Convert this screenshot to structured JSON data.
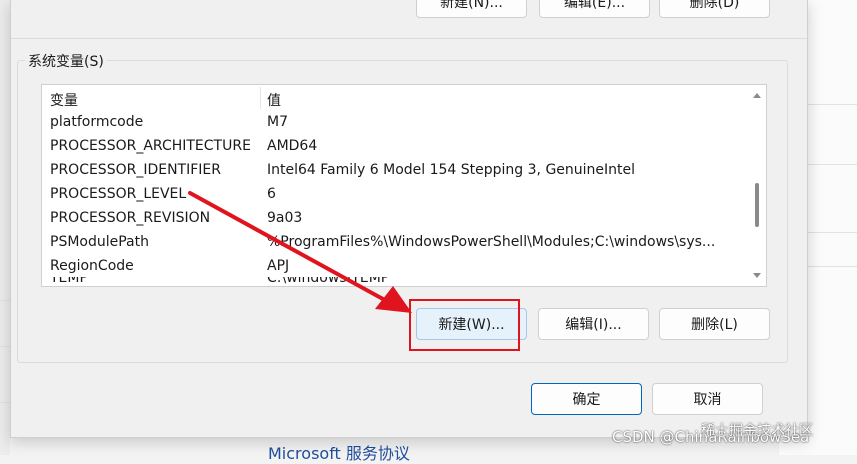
{
  "top_buttons": {
    "new_label": "新建(N)...",
    "edit_label": "编辑(E)...",
    "delete_label": "删除(D)"
  },
  "system_vars": {
    "group_label": "系统变量(S)",
    "columns": {
      "name": "变量",
      "value": "值"
    },
    "rows": [
      {
        "name": "platformcode",
        "value": "M7"
      },
      {
        "name": "PROCESSOR_ARCHITECTURE",
        "value": "AMD64"
      },
      {
        "name": "PROCESSOR_IDENTIFIER",
        "value": "Intel64 Family 6 Model 154 Stepping 3, GenuineIntel"
      },
      {
        "name": "PROCESSOR_LEVEL",
        "value": "6"
      },
      {
        "name": "PROCESSOR_REVISION",
        "value": "9a03"
      },
      {
        "name": "PSModulePath",
        "value": "%ProgramFiles%\\WindowsPowerShell\\Modules;C:\\windows\\sys..."
      },
      {
        "name": "RegionCode",
        "value": "APJ"
      },
      {
        "name": "TEMP",
        "value": "C:\\windows\\TEMP"
      }
    ],
    "new_label": "新建(W)...",
    "edit_label": "编辑(I)...",
    "delete_label": "删除(L)"
  },
  "footer": {
    "ok_label": "确定",
    "cancel_label": "取消"
  },
  "background": {
    "link_text": "Microsoft 服务协议"
  },
  "watermark": {
    "text": "CSDN @ChinaRainbowSea",
    "logo_text": "稀土掘金技术社区"
  },
  "colors": {
    "annotation_red": "#e0141e",
    "primary_border": "#0067c0",
    "link_blue": "#1f4e9c"
  }
}
